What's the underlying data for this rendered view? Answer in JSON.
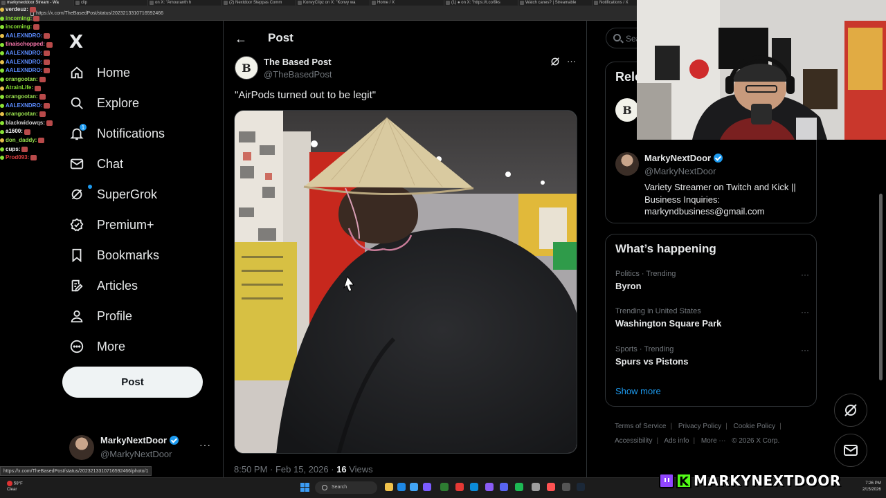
{
  "browser": {
    "tabs": [
      "markynextdoor Stream - Wa",
      "clip",
      "on X: \"Amouranth h",
      "(2) Nextdoor Steppas Comm",
      "KonvyClipz on X: \"Konvy wa",
      "Home / X",
      "(1) ● on X: \"https://t.co/9ks",
      "Watch canes? | Streamable",
      "Notifications / X",
      "(3) Instagram"
    ],
    "url": "https://x.com/TheBasedPost/status/2023213310716592466",
    "status_url": "https://x.com/TheBasedPost/status/2023213310716592466/photo/1"
  },
  "chat": {
    "lines": [
      {
        "user": "verdeuz:",
        "color": "#e3e3e3"
      },
      {
        "user": "incoming:",
        "color": "#8ae234"
      },
      {
        "user": "incoming:",
        "color": "#8ae234"
      },
      {
        "user": "AALEXNDRO:",
        "color": "#5b8cff"
      },
      {
        "user": "tinaischopped:",
        "color": "#ff7ab0"
      },
      {
        "user": "AALEXNDRO:",
        "color": "#5b8cff"
      },
      {
        "user": "AALEXNDRO:",
        "color": "#5b8cff"
      },
      {
        "user": "AALEXNDRO:",
        "color": "#5b8cff"
      },
      {
        "user": "orangootan:",
        "color": "#9be34f"
      },
      {
        "user": "AtrainLife:",
        "color": "#8ae234"
      },
      {
        "user": "orangootan:",
        "color": "#9be34f"
      },
      {
        "user": "AALEXNDRO:",
        "color": "#5b8cff"
      },
      {
        "user": "orangootan:",
        "color": "#9be34f"
      },
      {
        "user": "blackwidowqs:",
        "color": "#cfcfcf"
      },
      {
        "user": "a1600:",
        "color": "#ffffff"
      },
      {
        "user": "don_daddy:",
        "color": "#9be34f"
      },
      {
        "user": "cups:",
        "color": "#ffffff"
      },
      {
        "user": "Prod093:",
        "color": "#e04040"
      }
    ]
  },
  "nav": {
    "logo": "X",
    "items": [
      {
        "label": "Home",
        "icon": "home-icon"
      },
      {
        "label": "Explore",
        "icon": "search-icon"
      },
      {
        "label": "Notifications",
        "icon": "bell-icon",
        "badge": "1"
      },
      {
        "label": "Chat",
        "icon": "mail-icon"
      },
      {
        "label": "SuperGrok",
        "icon": "grok-icon"
      },
      {
        "label": "Premium+",
        "icon": "premium-icon"
      },
      {
        "label": "Bookmarks",
        "icon": "bookmark-icon"
      },
      {
        "label": "Articles",
        "icon": "articles-icon"
      },
      {
        "label": "Profile",
        "icon": "person-icon"
      },
      {
        "label": "More",
        "icon": "more-circle-icon"
      }
    ],
    "post_label": "Post",
    "account": {
      "name": "MarkyNextDoor",
      "handle": "@MarkyNextDoor",
      "more": "···"
    }
  },
  "main": {
    "title": "Post",
    "post": {
      "author_name": "The Based Post",
      "author_handle": "@TheBasedPost",
      "avatar_letter": "B",
      "more": "···",
      "text": "\"AirPods turned out to be legit\"",
      "timestamp": "8:50 PM · Feb 15, 2026 · ",
      "views_count": "16",
      "views_label": " Views"
    }
  },
  "sidebar": {
    "search_placeholder": "Sea",
    "relevant": {
      "title": "Rele",
      "avatar_letter": "B",
      "person_name": "MarkyNextDoor",
      "person_handle": "@MarkyNextDoor",
      "bio": "Variety Streamer on Twitch and Kick || Business Inquiries: markyndbusiness@gmail.com"
    },
    "happening": {
      "title": "What’s happening",
      "trends": [
        {
          "meta": "Politics · Trending",
          "name": "Byron"
        },
        {
          "meta": "Trending in United States",
          "name": "Washington Square Park"
        },
        {
          "meta": "Sports · Trending",
          "name": "Spurs vs Pistons"
        }
      ],
      "trend_more": "···",
      "show_more": "Show more"
    },
    "footer": {
      "links": [
        "Terms of Service",
        "Privacy Policy",
        "Cookie Policy",
        "Accessibility",
        "Ads info",
        "More ···"
      ],
      "copyright": "© 2026 X Corp."
    }
  },
  "taskbar": {
    "weather_temp": "58°F",
    "weather_desc": "Clear",
    "search_label": "Search",
    "time": "7:26 PM",
    "date": "2/15/2026"
  },
  "overlay": {
    "brand_k": "K",
    "brand_name": "MARKYNEXTDOOR"
  },
  "colors": {
    "accent": "#1d9bf0",
    "background": "#000000",
    "text_primary": "#e7e9ea",
    "text_secondary": "#71767b",
    "border": "#2f3336"
  }
}
